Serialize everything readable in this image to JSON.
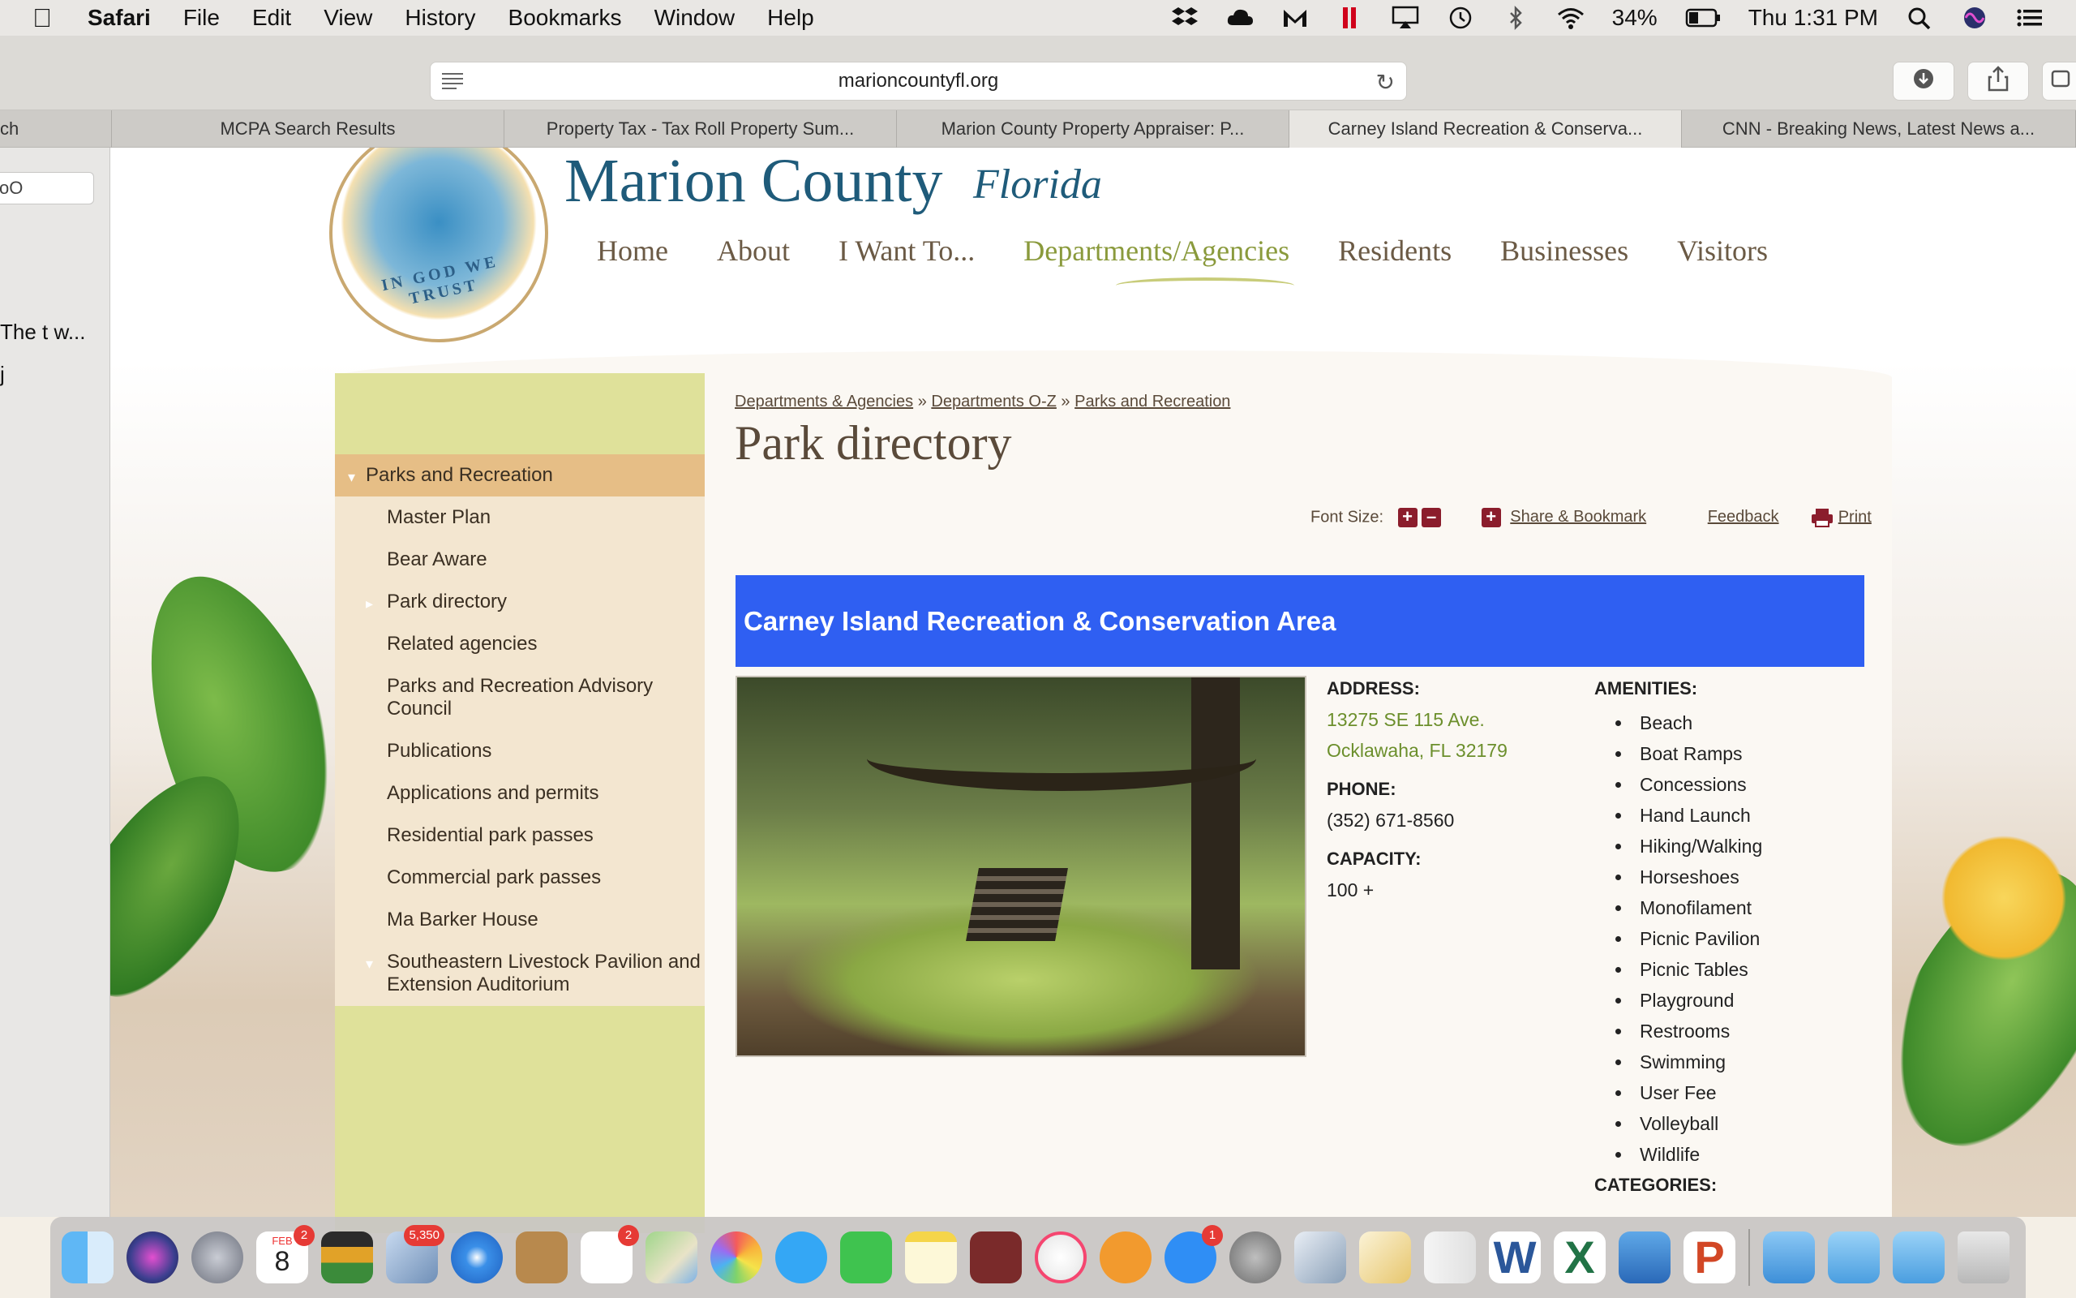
{
  "menubar": {
    "app": "Safari",
    "items": [
      "File",
      "Edit",
      "View",
      "History",
      "Bookmarks",
      "Window",
      "Help"
    ],
    "battery": "34%",
    "clock": "Thu 1:31 PM",
    "status_icons": [
      "dropbox-icon",
      "cloud-icon",
      "gmail-icon",
      "parallels-icon",
      "airplay-icon",
      "time-machine-icon",
      "bluetooth-icon",
      "wifi-icon",
      "battery-icon",
      "spotlight-icon",
      "siri-icon",
      "notification-center-icon"
    ]
  },
  "toolbar": {
    "url": "marioncountyfl.org"
  },
  "tabs": [
    {
      "label": "ch",
      "active": false
    },
    {
      "label": "MCPA Search Results",
      "active": false
    },
    {
      "label": "Property Tax - Tax Roll Property Sum...",
      "active": false
    },
    {
      "label": "Marion County Property Appraiser: P...",
      "active": false
    },
    {
      "label": "Carney Island Recreation & Conserva...",
      "active": true
    },
    {
      "label": "CNN - Breaking News, Latest News a...",
      "active": false
    }
  ],
  "sidebar": {
    "search_value": "oO",
    "lines": [
      "The t w...",
      "j"
    ]
  },
  "site": {
    "title": "Marion County",
    "subtitle": "Florida",
    "motto": "IN GOD WE TRUST",
    "nav": [
      "Home",
      "About",
      "I Want To...",
      "Departments/Agencies",
      "Residents",
      "Businesses",
      "Visitors"
    ],
    "active_nav": "Departments/Agencies"
  },
  "left_nav": {
    "head": "Parks and Recreation",
    "items": [
      "Master Plan",
      "Bear Aware",
      "Park directory",
      "Related agencies",
      "Parks and Recreation Advisory Council",
      "Publications",
      "Applications and permits",
      "Residential park passes",
      "Commercial park passes",
      "Ma Barker House",
      "Southeastern Livestock Pavilion and Extension Auditorium"
    ]
  },
  "breadcrumb": {
    "items": [
      "Departments & Agencies",
      "Departments O-Z",
      "Parks and Recreation"
    ],
    "separator": "»"
  },
  "page_title": "Park directory",
  "tools": {
    "font_size_label": "Font Size:",
    "share": "Share & Bookmark",
    "feedback": "Feedback",
    "print": "Print"
  },
  "park": {
    "name": "Carney Island Recreation & Conservation Area",
    "address_label": "ADDRESS:",
    "address_line1": "13275 SE 115 Ave.",
    "address_line2": "Ocklawaha, FL 32179",
    "phone_label": "PHONE:",
    "phone": "(352) 671-8560",
    "capacity_label": "CAPACITY:",
    "capacity": "100 +",
    "amenities_label": "AMENITIES:",
    "amenities": [
      "Beach",
      "Boat Ramps",
      "Concessions",
      "Hand Launch",
      "Hiking/Walking",
      "Horseshoes",
      "Monofilament",
      "Picnic Pavilion",
      "Picnic Tables",
      "Playground",
      "Restrooms",
      "Swimming",
      "User Fee",
      "Volleyball",
      "Wildlife"
    ],
    "categories_label": "CATEGORIES:"
  },
  "dock": {
    "calendar_date": "8",
    "calendar_month": "FEB",
    "badges": {
      "calendar": "2",
      "reminders": "2",
      "mail": "5,350",
      "app_store": "1"
    }
  },
  "colors": {
    "heading_bar": "#2f5ff2",
    "address_green": "#6c8f2c",
    "left_col": "#dfe19a",
    "nav_active": "#8a9a3c"
  }
}
